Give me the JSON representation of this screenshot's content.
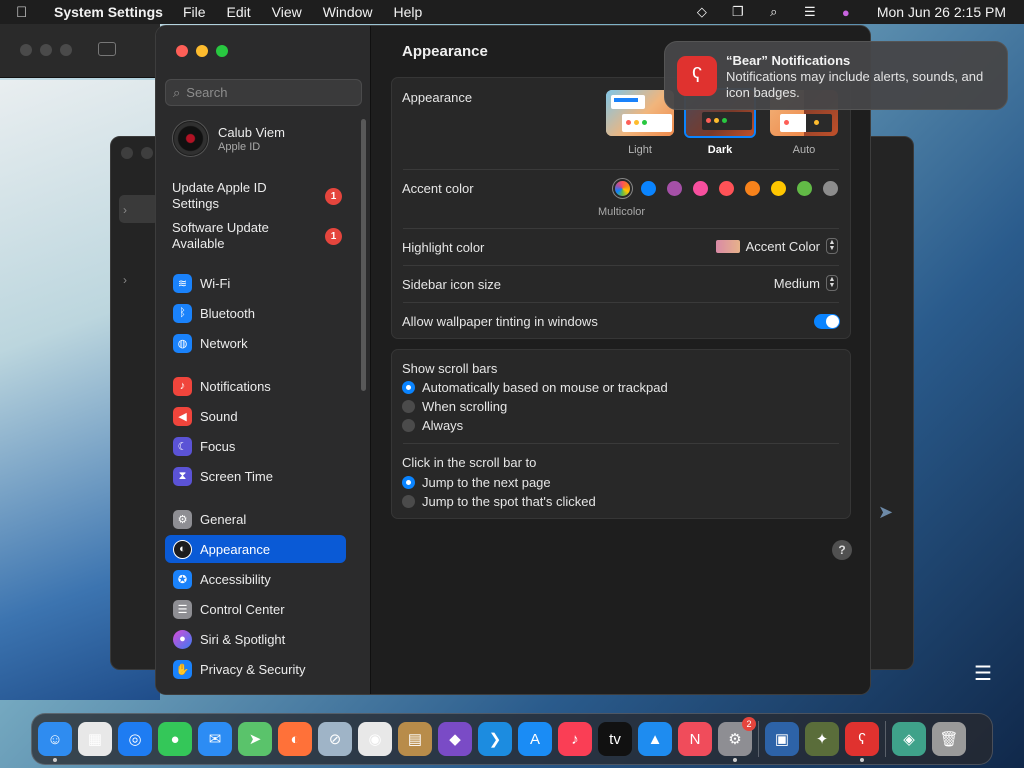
{
  "menubar": {
    "app_name": "System Settings",
    "menus": [
      "File",
      "Edit",
      "View",
      "Window",
      "Help"
    ],
    "clock": "Mon Jun 26  2:15 PM",
    "status_icons": [
      "diamond-icon",
      "screen-mirroring-icon",
      "search-icon",
      "control-center-icon",
      "siri-icon"
    ]
  },
  "sidebar": {
    "search_placeholder": "Search",
    "profile": {
      "name": "Calub Viem",
      "subtitle": "Apple ID"
    },
    "alerts": [
      {
        "label": "Update Apple ID Settings",
        "badge": "1"
      },
      {
        "label": "Software Update Available",
        "badge": "1"
      }
    ],
    "items": [
      {
        "label": "Wi-Fi",
        "icon": "wifi-icon",
        "color": "#1a82fb"
      },
      {
        "label": "Bluetooth",
        "icon": "bluetooth-icon",
        "color": "#1a82fb"
      },
      {
        "label": "Network",
        "icon": "globe-icon",
        "color": "#1a82fb"
      },
      {
        "label": "Notifications",
        "icon": "bell-icon",
        "color": "#f0453c"
      },
      {
        "label": "Sound",
        "icon": "speaker-icon",
        "color": "#f0453c"
      },
      {
        "label": "Focus",
        "icon": "moon-icon",
        "color": "#5b53d6"
      },
      {
        "label": "Screen Time",
        "icon": "hourglass-icon",
        "color": "#5b53d6"
      },
      {
        "label": "General",
        "icon": "gear-icon",
        "color": "#8e8e93"
      },
      {
        "label": "Appearance",
        "icon": "appearance-icon",
        "color": "#1c1c1e",
        "selected": true
      },
      {
        "label": "Accessibility",
        "icon": "accessibility-icon",
        "color": "#1a82fb"
      },
      {
        "label": "Control Center",
        "icon": "control-center-icon",
        "color": "#8e8e93"
      },
      {
        "label": "Siri & Spotlight",
        "icon": "siri-icon",
        "color": "#c43bd1"
      },
      {
        "label": "Privacy & Security",
        "icon": "hand-icon",
        "color": "#1a82fb"
      }
    ]
  },
  "main": {
    "title": "Appearance",
    "appearance": {
      "label": "Appearance",
      "options": [
        {
          "label": "Light",
          "selected": false
        },
        {
          "label": "Dark",
          "selected": true
        },
        {
          "label": "Auto",
          "selected": false
        }
      ]
    },
    "accent": {
      "label": "Accent color",
      "selected_label": "Multicolor",
      "colors": [
        "#ffffff",
        "#0a84ff",
        "#a550a7",
        "#f74f9e",
        "#ff5257",
        "#f7821b",
        "#ffc600",
        "#62ba46",
        "#8c8c8c"
      ]
    },
    "highlight": {
      "label": "Highlight color",
      "value": "Accent Color"
    },
    "sidebar_icon_size": {
      "label": "Sidebar icon size",
      "value": "Medium"
    },
    "wallpaper_tinting": {
      "label": "Allow wallpaper tinting in windows",
      "enabled": true
    },
    "scroll_bars": {
      "label": "Show scroll bars",
      "options": [
        {
          "label": "Automatically based on mouse or trackpad",
          "selected": true
        },
        {
          "label": "When scrolling",
          "selected": false
        },
        {
          "label": "Always",
          "selected": false
        }
      ]
    },
    "click_scroll": {
      "label": "Click in the scroll bar to",
      "options": [
        {
          "label": "Jump to the next page",
          "selected": true
        },
        {
          "label": "Jump to the spot that's clicked",
          "selected": false
        }
      ]
    },
    "help": "?"
  },
  "notification": {
    "title": "“Bear” Notifications",
    "body": "Notifications may include alerts, sounds, and icon badges."
  },
  "dock": {
    "apps": [
      {
        "name": "finder-icon",
        "color": "#2f8cf0",
        "glyph": "☺",
        "running": true
      },
      {
        "name": "launchpad-icon",
        "color": "#e8e8e8",
        "glyph": "▦"
      },
      {
        "name": "safari-icon",
        "color": "#1e7cf2",
        "glyph": "◎"
      },
      {
        "name": "messages-icon",
        "color": "#34c759",
        "glyph": "●"
      },
      {
        "name": "mail-icon",
        "color": "#2c8cf4",
        "glyph": "✉"
      },
      {
        "name": "maps-icon",
        "color": "#5ac36b",
        "glyph": "➤"
      },
      {
        "name": "firefox-icon",
        "color": "#ff7139",
        "glyph": "◐"
      },
      {
        "name": "no-entry-app-icon",
        "color": "#9fb4c7",
        "glyph": "⊘"
      },
      {
        "name": "chrome-icon",
        "color": "#e8e8e8",
        "glyph": "◉"
      },
      {
        "name": "archive-app-icon",
        "color": "#b88c4a",
        "glyph": "▤"
      },
      {
        "name": "visual-studio-icon",
        "color": "#7a4bc6",
        "glyph": "◆"
      },
      {
        "name": "vscode-icon",
        "color": "#1c8ce0",
        "glyph": "❯"
      },
      {
        "name": "app-store-icon",
        "color": "#1a8cf5",
        "glyph": "A"
      },
      {
        "name": "music-icon",
        "color": "#fa3e55",
        "glyph": "♪"
      },
      {
        "name": "apple-tv-icon",
        "color": "#111111",
        "glyph": "tv"
      },
      {
        "name": "keynote-icon",
        "color": "#1e8cf0",
        "glyph": "▲"
      },
      {
        "name": "news-icon",
        "color": "#f04c5b",
        "glyph": "N"
      },
      {
        "name": "system-settings-icon",
        "color": "#8e8e93",
        "glyph": "⚙",
        "badge": "2",
        "running": true
      }
    ],
    "apps_after_sep": [
      {
        "name": "virtualbox-icon",
        "color": "#2d63a8",
        "glyph": "▣"
      },
      {
        "name": "utility-app-icon",
        "color": "#5a6d3a",
        "glyph": "✦"
      },
      {
        "name": "bear-icon",
        "color": "#e0322f",
        "glyph": "ʕ",
        "running": true
      }
    ],
    "apps_end": [
      {
        "name": "downloads-stack-icon",
        "color": "#3fa28a",
        "glyph": "◈"
      },
      {
        "name": "trash-icon",
        "color": "#9a9a9a",
        "glyph": "🗑"
      }
    ]
  }
}
